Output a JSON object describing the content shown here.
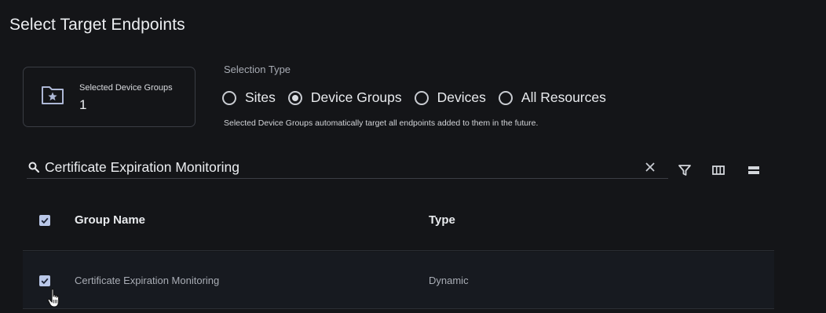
{
  "page": {
    "title": "Select Target Endpoints"
  },
  "summary": {
    "label": "Selected Device Groups",
    "count": "1",
    "icon": "folder-star-icon"
  },
  "selection_type": {
    "label": "Selection Type",
    "options": [
      {
        "label": "Sites",
        "checked": false
      },
      {
        "label": "Device Groups",
        "checked": true
      },
      {
        "label": "Devices",
        "checked": false
      },
      {
        "label": "All Resources",
        "checked": false
      }
    ],
    "hint": "Selected Device Groups automatically target all endpoints added to them in the future."
  },
  "search": {
    "value": "Certificate Expiration Monitoring"
  },
  "toolbar": {
    "icons": [
      "filter-icon",
      "columns-icon",
      "density-icon"
    ]
  },
  "table": {
    "columns": [
      "Group Name",
      "Type"
    ],
    "rows": [
      {
        "name": "Certificate Expiration Monitoring",
        "type": "Dynamic",
        "checked": true
      }
    ]
  },
  "colors": {
    "background": "#141518",
    "checkbox": "#b9c7e8",
    "row_bg": "#171a20"
  }
}
